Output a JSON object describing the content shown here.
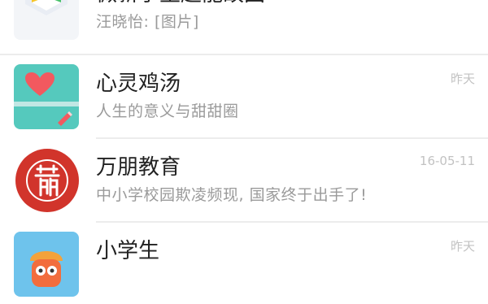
{
  "chats": [
    {
      "title": "微新学生超能故国",
      "preview": "汪晓怡: [图片]",
      "time": "",
      "avatar": "teaching-app-logo-icon"
    },
    {
      "title": "心灵鸡汤",
      "preview": "人生的意义与甜甜圈",
      "time": "昨天",
      "avatar": "heart-logo-icon"
    },
    {
      "title": "万朋教育",
      "preview": "中小学校园欺凌频现, 国家终于出手了!",
      "time": "16-05-11",
      "avatar": "wanpeng-seal-logo-icon"
    },
    {
      "title": "小学生",
      "preview": "",
      "time": "昨天",
      "avatar": "pupil-mascot-icon"
    }
  ],
  "colors": {
    "title": "#222222",
    "preview": "#9a9a9a",
    "time": "#c2c2c2",
    "divider": "#ececec",
    "teal": "#55c9bd",
    "red": "#d1342b",
    "blue": "#6ec3ec"
  }
}
